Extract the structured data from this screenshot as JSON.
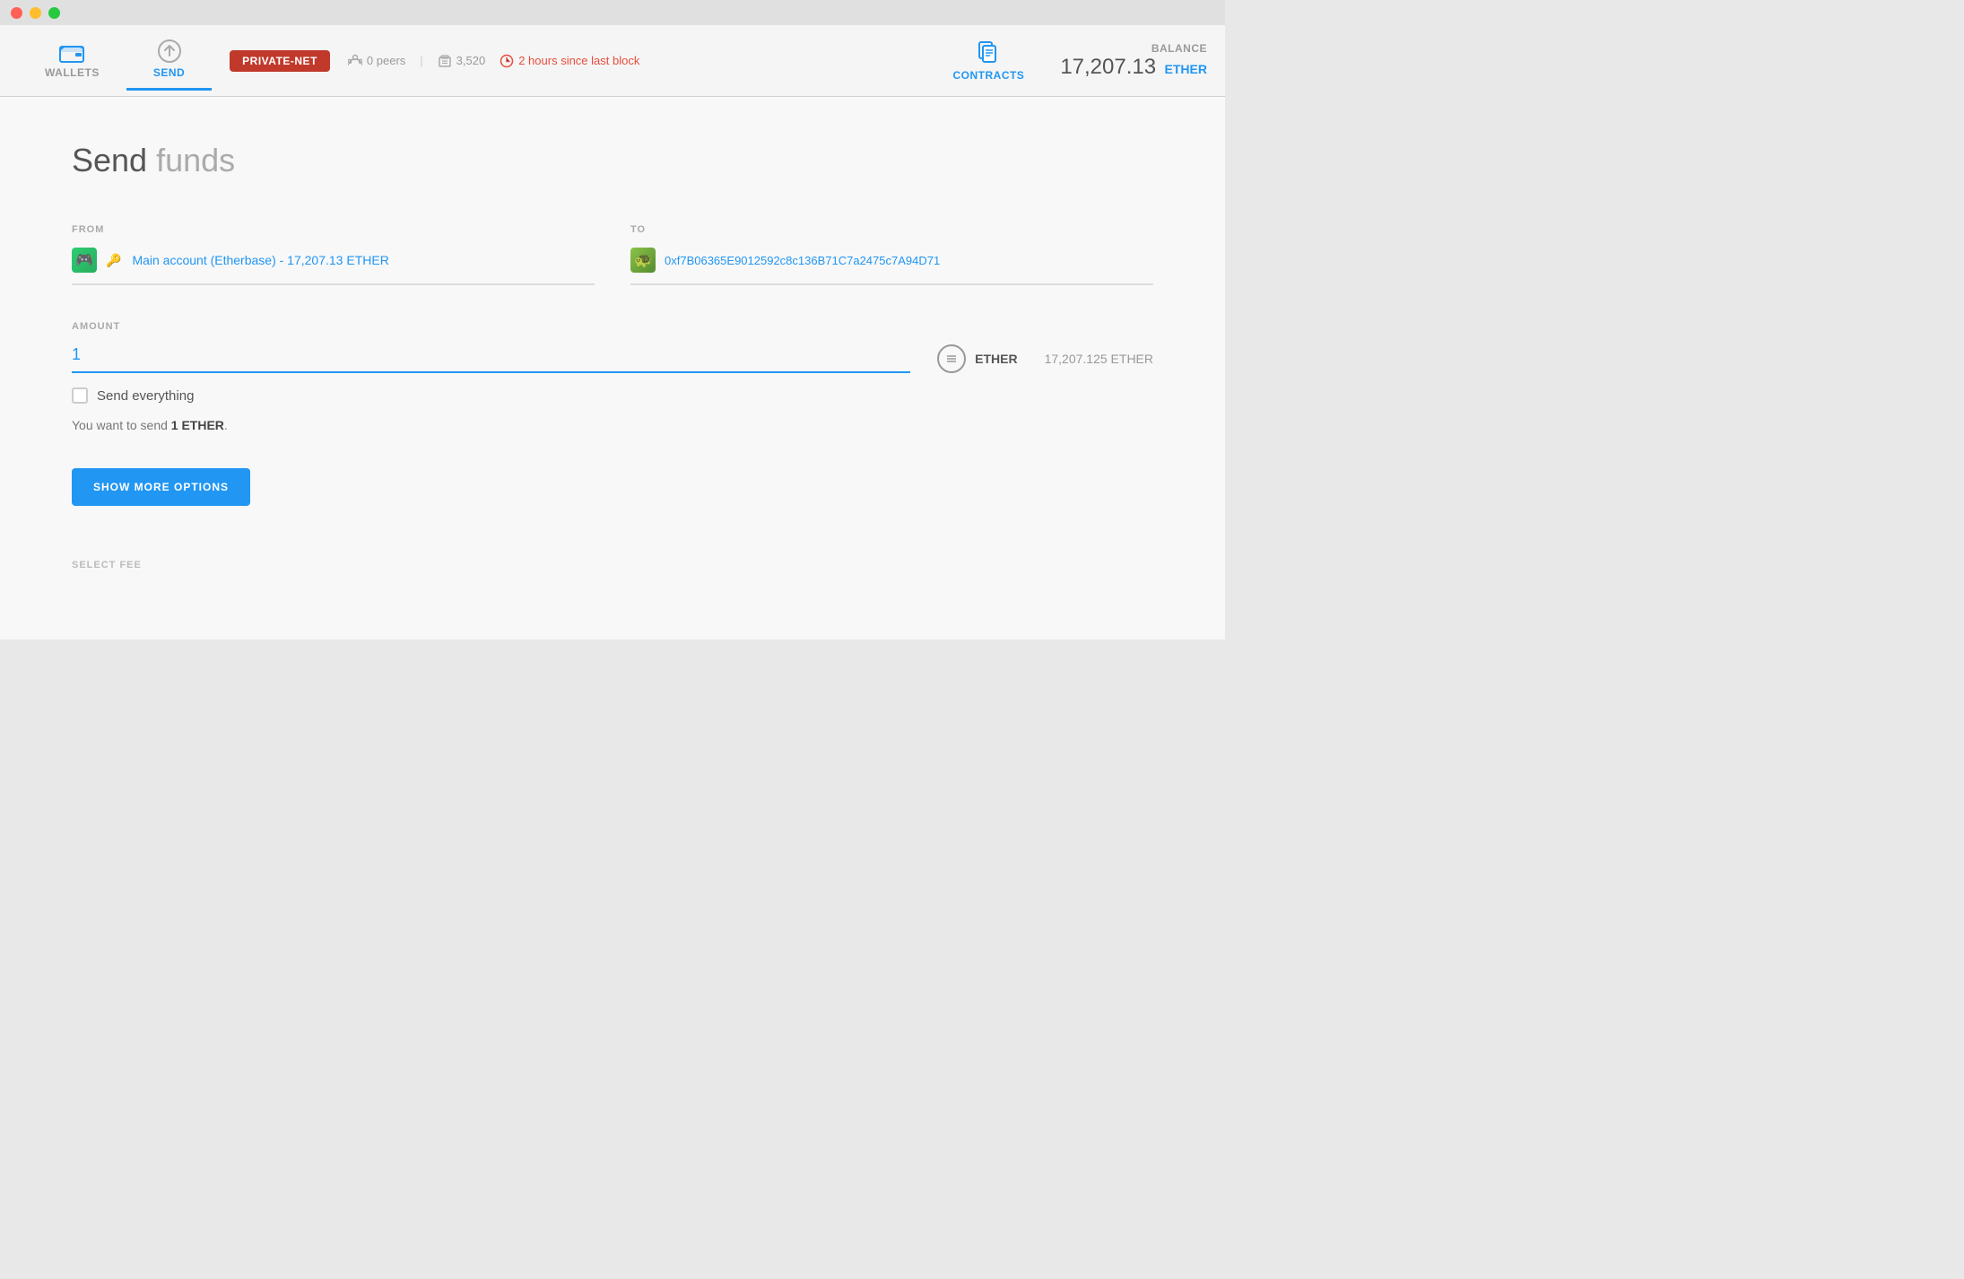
{
  "titlebar": {
    "btn_red": "close",
    "btn_yellow": "minimize",
    "btn_green": "maximize"
  },
  "navbar": {
    "wallets_label": "WALLETS",
    "send_label": "SEND",
    "private_net": "PRIVATE-NET",
    "peers": "0 peers",
    "blocks": "3,520",
    "time": "2 hours since last block",
    "contracts_label": "CONTRACTS",
    "balance_label": "BALANCE",
    "balance_value": "17,207.13",
    "balance_currency": "ETHER"
  },
  "page": {
    "title_bold": "Send",
    "title_light": " funds"
  },
  "from": {
    "label": "FROM",
    "account_name": "Main account (Etherbase) - 17,207.13 ETHER"
  },
  "to": {
    "label": "TO",
    "address": "0xf7B06365E9012592c8c136B71C7a2475c7A94D71"
  },
  "amount": {
    "label": "AMOUNT",
    "value": "1",
    "currency": "ETHER",
    "available": "17,207.125 ETHER",
    "send_everything_label": "Send everything",
    "summary_prefix": "You want to send ",
    "summary_amount": "1 ETHER",
    "summary_suffix": "."
  },
  "buttons": {
    "show_more": "SHOW MORE OPTIONS"
  },
  "select_fee": {
    "label": "SELECT FEE"
  }
}
